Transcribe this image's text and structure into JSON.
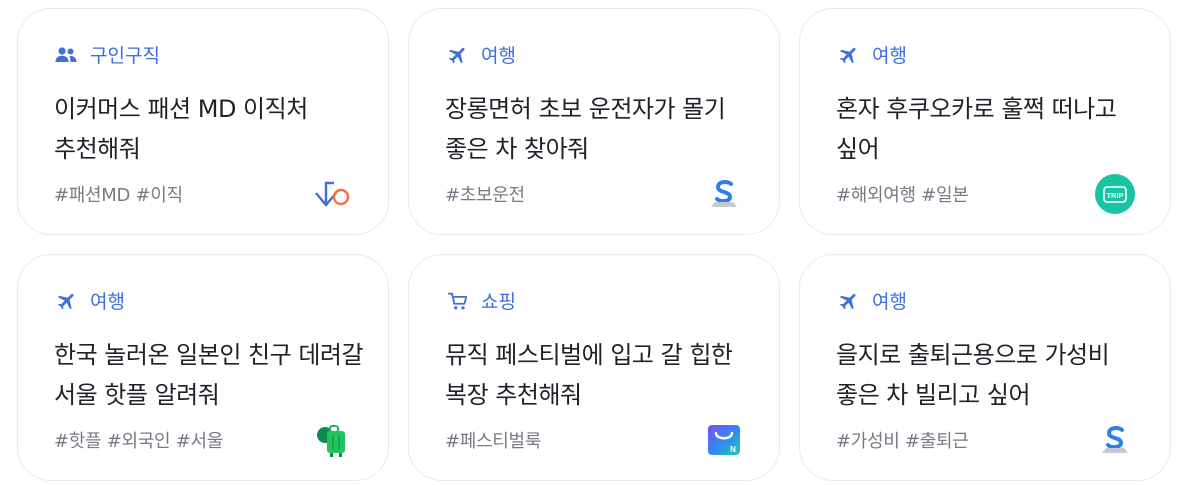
{
  "cards": [
    {
      "category": "구인구직",
      "category_icon": "people-icon",
      "title": "이커머스 패션 MD 이직처 추천해줘",
      "tags": "#패션MD #이직",
      "logo": "job-service-logo"
    },
    {
      "category": "여행",
      "category_icon": "airplane-icon",
      "title": "장롱면허 초보 운전자가 몰기 좋은 차 찾아줘",
      "tags": "#초보운전",
      "logo": "car-share-logo"
    },
    {
      "category": "여행",
      "category_icon": "airplane-icon",
      "title": "혼자 후쿠오카로 훌쩍 떠나고 싶어",
      "tags": "#해외여행 #일본",
      "logo": "trip-logo",
      "logo_text": "TRIP"
    },
    {
      "category": "여행",
      "category_icon": "airplane-icon",
      "title": "한국 놀러온 일본인 친구 데려갈 서울 핫플 알려줘",
      "tags": "#핫플 #외국인 #서울",
      "logo": "travel-suitcase-logo"
    },
    {
      "category": "쇼핑",
      "category_icon": "cart-icon",
      "title": "뮤직 페스티벌에 입고 갈 힙한 복장 추천해줘",
      "tags": "#페스티벌룩",
      "logo": "shopping-bag-logo",
      "logo_text": "N"
    },
    {
      "category": "여행",
      "category_icon": "airplane-icon",
      "title": "을지로 출퇴근용으로 가성비 좋은 차 빌리고 싶어",
      "tags": "#가성비 #출퇴근",
      "logo": "car-share-logo"
    }
  ],
  "colors": {
    "accent": "#3f6fd8",
    "title": "#1f2329",
    "tags": "#767b85",
    "border": "#e8eaee"
  }
}
